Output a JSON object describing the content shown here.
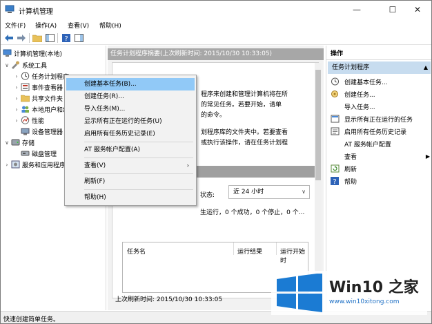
{
  "window": {
    "title": "计算机管理"
  },
  "menubar": [
    "文件(F)",
    "操作(A)",
    "查看(V)",
    "帮助(H)"
  ],
  "tree": {
    "root": "计算机管理(本地)",
    "items": [
      "系统工具",
      "任务计划程序",
      "事件查看器",
      "共享文件夹",
      "本地用户和组",
      "性能",
      "设备管理器",
      "存储",
      "磁盘管理",
      "服务和应用程序"
    ]
  },
  "middle": {
    "header": "任务计划程序摘要(上次刷新时间: 2015/10/30 10:33:05)",
    "desc_lines": [
      "程序来创建和管理计算机将在所",
      "的常见任务。若要开始，请单",
      "的命令。"
    ],
    "desc2_lines": [
      "划程序库的文件夹中。若要查看",
      "或执行该操作，请在任务计划程"
    ],
    "state_label": "状态:",
    "select_value": "近 24 小时",
    "summary": "生运行，0 个成功，0 个停止，0 个...",
    "columns": [
      "任务名",
      "运行结果",
      "运行开始时"
    ],
    "last_refresh": "上次刷新时间: 2015/10/30 10:33:05"
  },
  "actions": {
    "header": "操作",
    "section": "任务计划程序",
    "items": [
      "创建基本任务...",
      "创建任务...",
      "导入任务...",
      "显示所有正在运行的任务",
      "启用所有任务历史记录",
      "AT 服务帐户配置",
      "查看",
      "刷新",
      "帮助"
    ]
  },
  "context_menu": [
    "创建基本任务(B)...",
    "创建任务(R)...",
    "导入任务(M)...",
    "显示所有正在运行的任务(U)",
    "启用所有任务历史记录(E)",
    "AT 服务帐户配置(A)",
    "查看(V)",
    "刷新(F)",
    "帮助(H)"
  ],
  "status": "快速创建简单任务。",
  "watermark": {
    "brand": "Win10 之家",
    "url": "www.win10xitong.com"
  },
  "colors": {
    "highlight": "#91c9f7",
    "section_bg": "#c7dcef",
    "logo_blue": "#1b7bd3"
  }
}
